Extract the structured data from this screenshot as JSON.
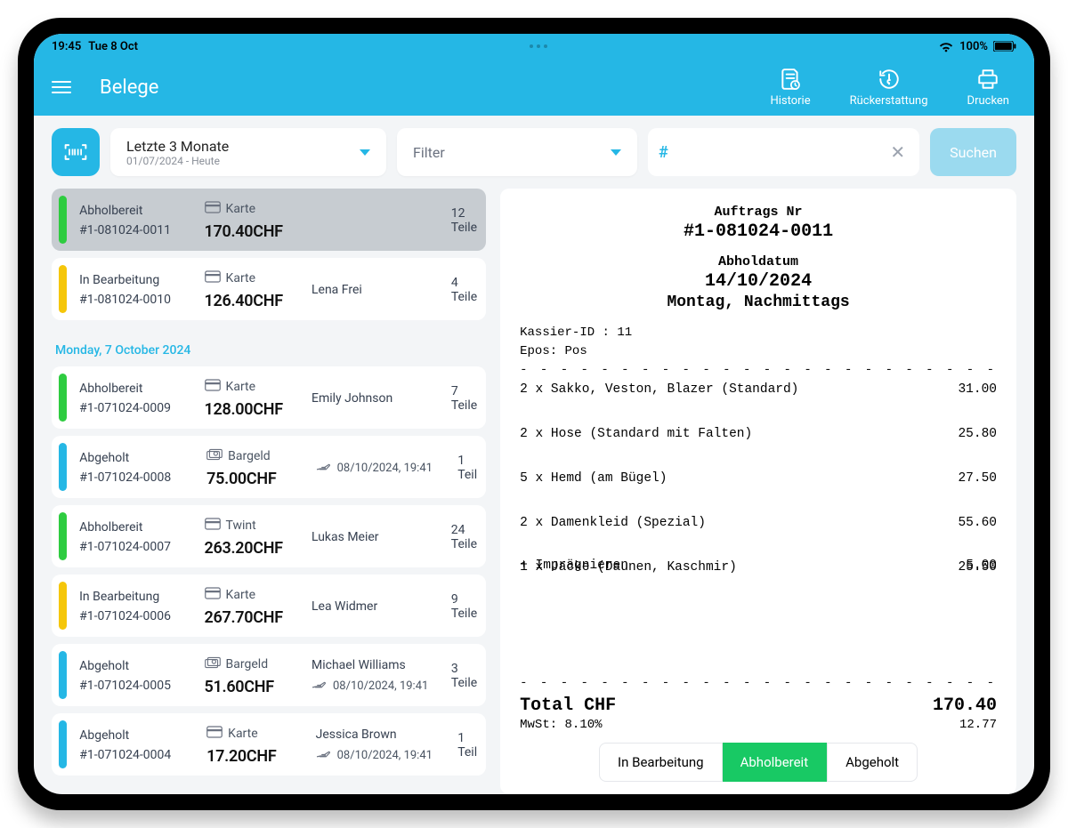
{
  "status_bar": {
    "time": "19:45",
    "date": "Tue 8 Oct",
    "battery": "100%"
  },
  "header": {
    "title": "Belege",
    "history": "Historie",
    "refund": "Rückerstattung",
    "print": "Drucken"
  },
  "filters": {
    "range_label": "Letzte 3 Monate",
    "range_sub": "01/07/2024 - Heute",
    "filter_label": "Filter",
    "hash": "#",
    "search_label": "Suchen"
  },
  "sections": [
    {
      "date_header": null,
      "rows": [
        {
          "status": "Abholbereit",
          "stripe": "st-green",
          "id": "#1-081024-0011",
          "pay_method": "Karte",
          "pay_icon": "card",
          "amount": "170.40CHF",
          "customer": "",
          "timestamp": "",
          "pieces": "12 Teile",
          "selected": true
        },
        {
          "status": "In Bearbeitung",
          "stripe": "st-yellow",
          "id": "#1-081024-0010",
          "pay_method": "Karte",
          "pay_icon": "card",
          "amount": "126.40CHF",
          "customer": "Lena Frei",
          "timestamp": "",
          "pieces": "4 Teile",
          "selected": false
        }
      ]
    },
    {
      "date_header": "Monday, 7 October 2024",
      "rows": [
        {
          "status": "Abholbereit",
          "stripe": "st-green",
          "id": "#1-071024-0009",
          "pay_method": "Karte",
          "pay_icon": "card",
          "amount": "128.00CHF",
          "customer": "Emily Johnson",
          "timestamp": "",
          "pieces": "7 Teile",
          "selected": false
        },
        {
          "status": "Abgeholt",
          "stripe": "st-blue",
          "id": "#1-071024-0008",
          "pay_method": "Bargeld",
          "pay_icon": "cash",
          "amount": "75.00CHF",
          "customer": "",
          "timestamp": "08/10/2024, 19:41",
          "pieces": "1 Teil",
          "selected": false
        },
        {
          "status": "Abholbereit",
          "stripe": "st-green",
          "id": "#1-071024-0007",
          "pay_method": "Twint",
          "pay_icon": "card",
          "amount": "263.20CHF",
          "customer": "Lukas Meier",
          "timestamp": "",
          "pieces": "24 Teile",
          "selected": false
        },
        {
          "status": "In Bearbeitung",
          "stripe": "st-yellow",
          "id": "#1-071024-0006",
          "pay_method": "Karte",
          "pay_icon": "card",
          "amount": "267.70CHF",
          "customer": "Lea Widmer",
          "timestamp": "",
          "pieces": "9 Teile",
          "selected": false
        },
        {
          "status": "Abgeholt",
          "stripe": "st-blue",
          "id": "#1-071024-0005",
          "pay_method": "Bargeld",
          "pay_icon": "cash",
          "amount": "51.60CHF",
          "customer": "Michael Williams",
          "timestamp": "08/10/2024, 19:41",
          "pieces": "3 Teile",
          "selected": false
        },
        {
          "status": "Abgeholt",
          "stripe": "st-blue",
          "id": "#1-071024-0004",
          "pay_method": "Karte",
          "pay_icon": "card",
          "amount": "17.20CHF",
          "customer": "Jessica Brown",
          "timestamp": "08/10/2024, 19:41",
          "pieces": "1 Teil",
          "selected": false
        }
      ]
    }
  ],
  "receipt": {
    "order_label": "Auftrags Nr",
    "order_id": "#1-081024-0011",
    "pickup_label": "Abholdatum",
    "pickup_date": "14/10/2024",
    "pickup_slot": "Montag, Nachmittags",
    "cashier_line": "Kassier-ID : 11",
    "epos_line": "Epos: Pos",
    "lines": [
      {
        "desc": "2 x Sakko, Veston, Blazer (Standard)",
        "price": "31.00",
        "spaced": true
      },
      {
        "desc": "2 x Hose (Standard mit Falten)",
        "price": "25.80",
        "spaced": true
      },
      {
        "desc": "5 x Hemd (am Bügel)",
        "price": "27.50",
        "spaced": true
      },
      {
        "desc": "2 x Damenkleid (Spezial)",
        "price": "55.60",
        "spaced": true
      },
      {
        "desc": "1 x Jacke (Daunen, Kaschmir)",
        "price": "25.50",
        "spaced": false
      },
      {
        "desc": "+ Imprägnieren",
        "price": "5.00",
        "spaced": false
      }
    ],
    "total_label": "Total CHF",
    "total_value": "170.40",
    "vat_label": "MwSt: 8.10%",
    "vat_value": "12.77",
    "buttons": {
      "b1": "In Bearbeitung",
      "b2": "Abholbereit",
      "b3": "Abgeholt"
    }
  }
}
